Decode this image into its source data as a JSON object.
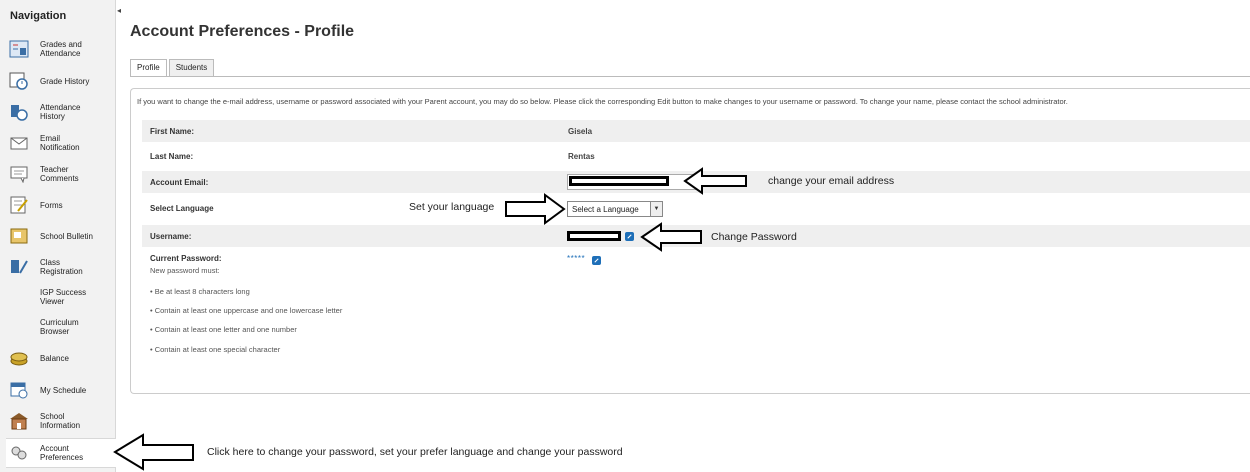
{
  "sidebar": {
    "title": "Navigation",
    "items": [
      {
        "label_1": "Grades and",
        "label_2": "Attendance",
        "icon": "grades-icon"
      },
      {
        "label_1": "Grade History",
        "label_2": "",
        "icon": "grade-history-icon"
      },
      {
        "label_1": "Attendance",
        "label_2": "History",
        "icon": "attendance-history-icon"
      },
      {
        "label_1": "Email",
        "label_2": "Notification",
        "icon": "email-icon"
      },
      {
        "label_1": "Teacher",
        "label_2": "Comments",
        "icon": "comments-icon"
      },
      {
        "label_1": "Forms",
        "label_2": "",
        "icon": "forms-icon"
      },
      {
        "label_1": "School Bulletin",
        "label_2": "",
        "icon": "bulletin-icon"
      },
      {
        "label_1": "Class",
        "label_2": "Registration",
        "icon": "class-registration-icon"
      },
      {
        "label_1": "IGP Success",
        "label_2": "Viewer",
        "icon": ""
      },
      {
        "label_1": "Curriculum",
        "label_2": "Browser",
        "icon": ""
      },
      {
        "label_1": "Balance",
        "label_2": "",
        "icon": "balance-icon"
      },
      {
        "label_1": "My Schedule",
        "label_2": "",
        "icon": "schedule-icon"
      },
      {
        "label_1": "School",
        "label_2": "Information",
        "icon": "school-icon"
      },
      {
        "label_1": "Account",
        "label_2": "Preferences",
        "icon": "account-preferences-icon"
      }
    ]
  },
  "page": {
    "title": "Account Preferences - Profile",
    "tabs": [
      "Profile",
      "Students"
    ],
    "intro": "If you want to change the e-mail address, username or password associated with your Parent account, you may do so below. Please click the corresponding Edit button to make changes to your username or password. To change your name, please contact the school administrator."
  },
  "profile": {
    "first_name_label": "First Name:",
    "first_name": "Gisela",
    "last_name_label": "Last Name:",
    "last_name": "Rentas",
    "email_label": "Account Email:",
    "language_label": "Select Language",
    "language_selected": "Select a Language",
    "username_label": "Username:",
    "current_password_label": "Current Password:",
    "password_mask": "*****",
    "new_password_intro": "New password must:",
    "requirements": [
      "• Be at least 8 characters long",
      "• Contain at least one uppercase and one lowercase letter",
      "• Contain at least one letter and one number",
      "• Contain at least one special character"
    ]
  },
  "annotations": {
    "email": "change your email address",
    "language": "Set your language",
    "password": "Change Password",
    "sidebar": "Click here to change your password, set your prefer language and change your password"
  }
}
